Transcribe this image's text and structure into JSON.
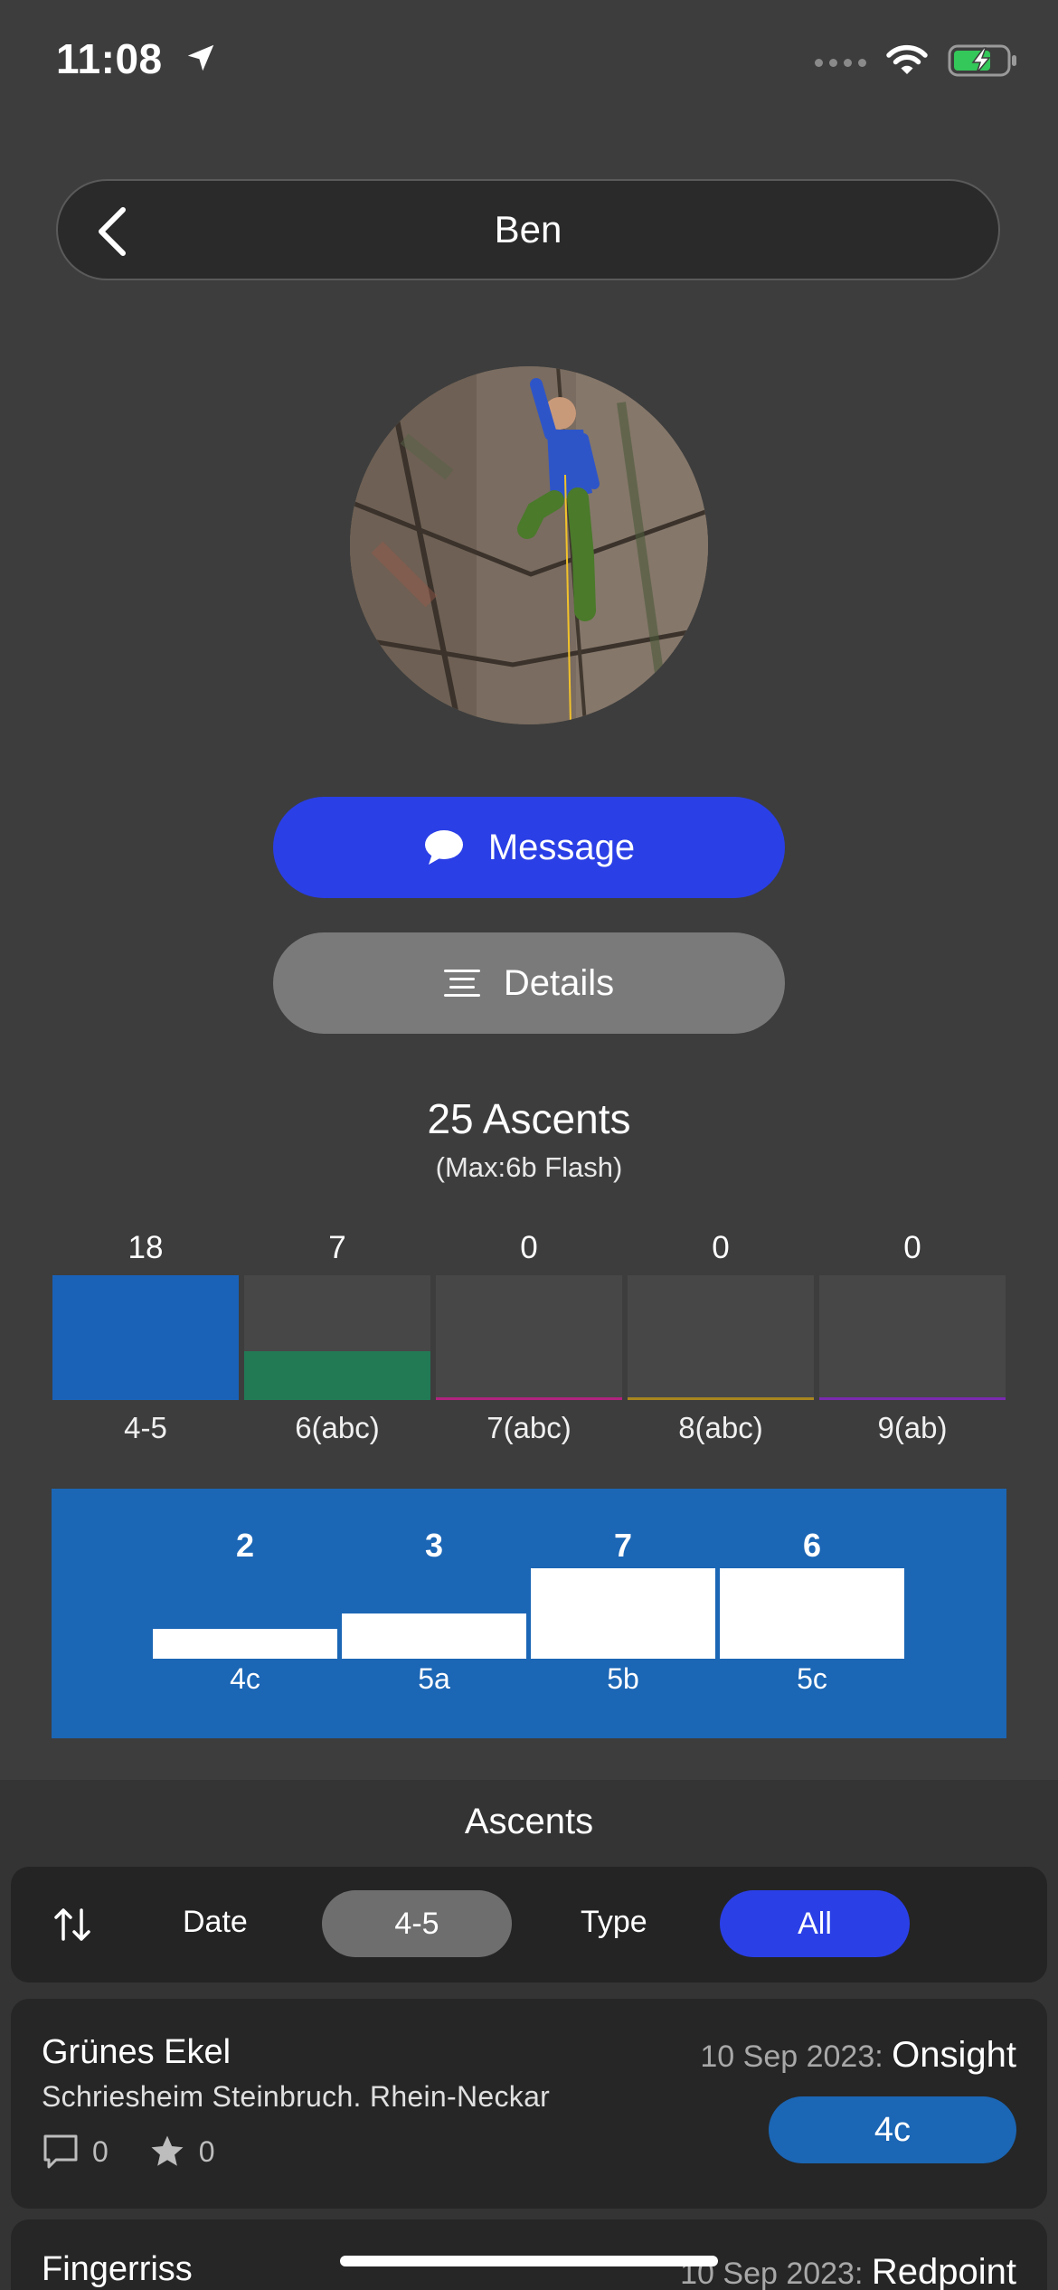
{
  "status_bar": {
    "time": "11:08"
  },
  "header": {
    "title": "Ben"
  },
  "actions": {
    "message_label": "Message",
    "details_label": "Details"
  },
  "summary": {
    "count_text": "25 Ascents",
    "max_text": "(Max:6b Flash)"
  },
  "colors": {
    "background": "#3d3d3d",
    "primary_blue": "#2a3fe6",
    "chart_blue": "#1b66b5",
    "band_green": "#227a55",
    "band_magenta": "#b0237e",
    "band_gold": "#a8861f",
    "band_purple": "#7a2ab0"
  },
  "chart_data": [
    {
      "type": "bar",
      "categories": [
        "4-5",
        "6(abc)",
        "7(abc)",
        "8(abc)",
        "9(ab)"
      ],
      "values": [
        18,
        7,
        0,
        0,
        0
      ],
      "value_labels": [
        "18",
        "7",
        "0",
        "0",
        "0"
      ],
      "colors": [
        "#1a62b8",
        "#227a55",
        "#b0237e",
        "#a8861f",
        "#7a2ab0"
      ],
      "ylim": [
        0,
        18
      ]
    },
    {
      "type": "bar",
      "categories": [
        "4c",
        "5a",
        "5b",
        "5c"
      ],
      "values": [
        2,
        3,
        7,
        6
      ],
      "value_labels": [
        "2",
        "3",
        "7",
        "6"
      ],
      "ylim": [
        0,
        6
      ]
    }
  ],
  "list": {
    "title": "Ascents",
    "filters": {
      "sort_icon": "sort-arrows-icon",
      "date_label": "Date",
      "grade_value": "4-5",
      "type_label": "Type",
      "type_value": "All"
    },
    "items": [
      {
        "name": "Grünes Ekel",
        "location": "Schriesheim Steinbruch. Rhein-Neckar",
        "comments": "0",
        "stars": "0",
        "date": "10 Sep 2023:",
        "style": "Onsight",
        "grade": "4c"
      },
      {
        "name": "Fingerriss",
        "date": "10 Sep 2023:",
        "style": "Redpoint"
      }
    ]
  }
}
